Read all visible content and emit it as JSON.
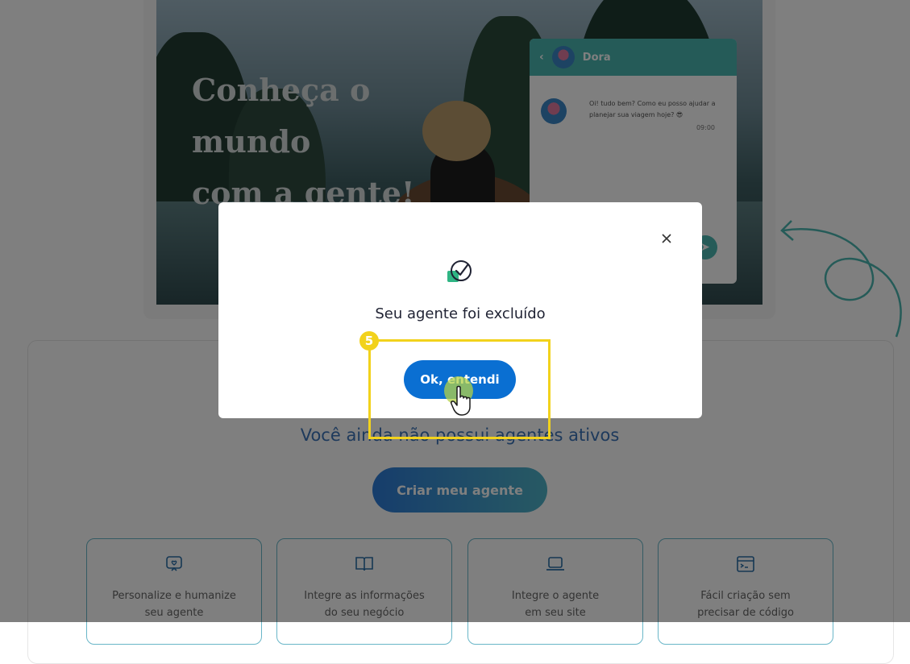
{
  "hero": {
    "title_line1": "Conheça o mundo",
    "title_line2": "com a gente!"
  },
  "chat": {
    "agent_name": "Dora",
    "message": "Oi! tudo bem? Como eu posso ajudar a planejar sua viagem hoje? 😎",
    "time": "09:00"
  },
  "main": {
    "empty_state": "Você ainda não possui agentes ativos",
    "create_button": "Criar meu agente",
    "features": [
      {
        "icon": "chat-heart-icon",
        "line1": "Personalize e humanize",
        "line2": "seu agente"
      },
      {
        "icon": "book-icon",
        "line1": "Integre as informações",
        "line2": "do seu negócio"
      },
      {
        "icon": "laptop-icon",
        "line1": "Integre o agente",
        "line2": "em seu site"
      },
      {
        "icon": "code-window-icon",
        "line1": "Fácil criação sem",
        "line2": "precisar de código"
      }
    ]
  },
  "modal": {
    "title": "Seu agente foi excluído",
    "ok_button": "Ok, entendi",
    "close_icon": "close-icon",
    "status_icon": "check-circle-icon"
  },
  "annotation": {
    "step": "5",
    "highlight_color": "#f2d21c"
  },
  "colors": {
    "primary": "#0a6fd2",
    "teal": "#4bb6b0",
    "text_dark": "#1f2233"
  }
}
